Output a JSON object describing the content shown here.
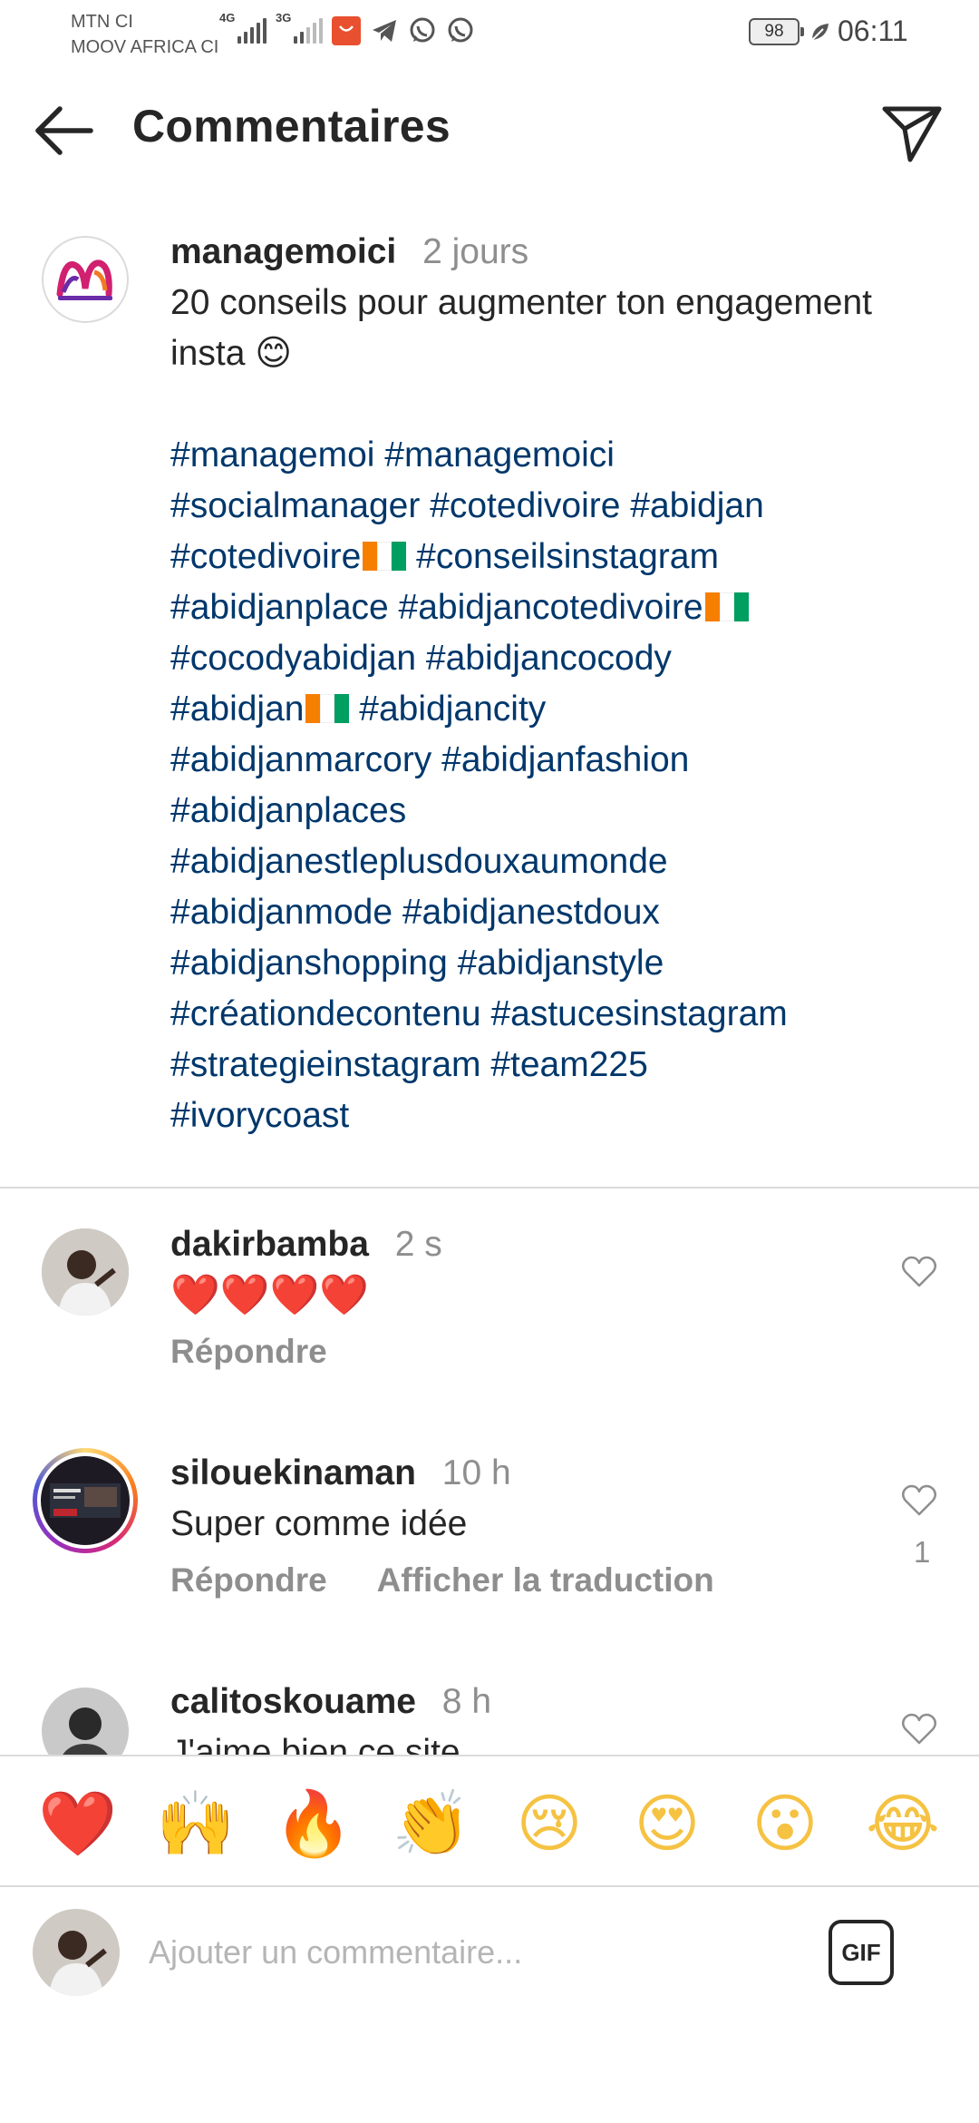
{
  "status_bar": {
    "carrier_1": "MTN CI",
    "carrier_2": "MOOV AFRICA CI",
    "network_1": "4G",
    "network_2": "3G",
    "battery": "98",
    "time": "06:11"
  },
  "header": {
    "title": "Commentaires",
    "back_icon": "arrow-left-icon",
    "share_icon": "paper-plane-icon"
  },
  "caption": {
    "username": "managemoici",
    "time": "2 jours",
    "text": "20 conseils pour augmenter ton engagement insta",
    "emoji": "😊",
    "hashtag_lines": [
      [
        "#managemoi #managemoici",
        ""
      ],
      [
        "#socialmanager #cotedivoire #abidjan",
        ""
      ],
      [
        "#cotedivoire",
        "flag",
        " #conseilsinstagram"
      ],
      [
        "#abidjanplace #abidjancotedivoire",
        "flag",
        ""
      ],
      [
        "#cocodyabidjan #abidjancocody",
        ""
      ],
      [
        "#abidjan",
        "flag",
        " #abidjancity"
      ],
      [
        "#abidjanmarcory #abidjanfashion",
        ""
      ],
      [
        "#abidjanplaces",
        ""
      ],
      [
        "#abidjanestleplusdouxaumonde",
        ""
      ],
      [
        "#abidjanmode #abidjanestdoux",
        ""
      ],
      [
        "#abidjanshopping #abidjanstyle",
        ""
      ],
      [
        "#créationdecontenu #astucesinstagram",
        ""
      ],
      [
        "#strategieinstagram #team225",
        ""
      ],
      [
        "#ivorycoast",
        ""
      ]
    ]
  },
  "comments": [
    {
      "username": "dakirbamba",
      "time": "2 s",
      "text": "❤️❤️❤️❤️",
      "reply": "Répondre",
      "translate": "",
      "likes": ""
    },
    {
      "username": "silouekinaman",
      "time": "10 h",
      "text": "Super comme idée",
      "reply": "Répondre",
      "translate": "Afficher la traduction",
      "likes": "1"
    },
    {
      "username": "calitoskouame",
      "time": "8 h",
      "text": "J'aime bien ce site",
      "reply": "",
      "translate": "",
      "likes": ""
    }
  ],
  "emoji_bar": [
    "❤️",
    "🙌",
    "🔥",
    "👏",
    "😢",
    "😍",
    "😮",
    "😂"
  ],
  "composer": {
    "placeholder": "Ajouter un commentaire...",
    "gif_label": "GIF"
  },
  "colors": {
    "hashtag": "#00376b",
    "secondary_text": "#8e8e8e",
    "divider": "#dbdbdb",
    "heart_red": "#ed4956"
  }
}
